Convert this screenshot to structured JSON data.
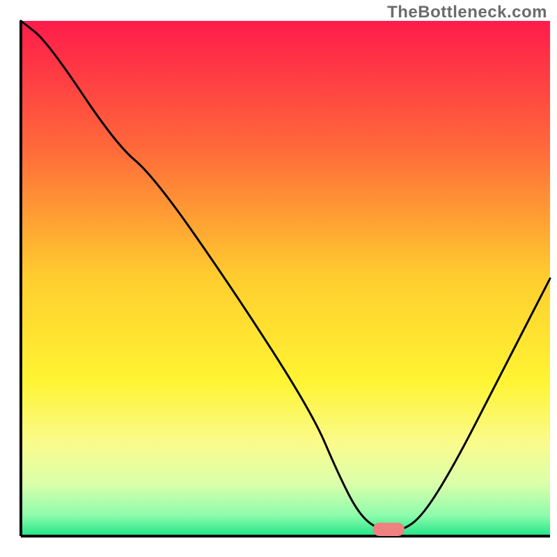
{
  "watermark": "TheBottleneck.com",
  "chart_data": {
    "type": "line",
    "title": "",
    "xlabel": "",
    "ylabel": "",
    "xlim": [
      0,
      100
    ],
    "ylim": [
      0,
      100
    ],
    "background": {
      "type": "vertical-gradient",
      "stops": [
        {
          "offset": 0.0,
          "color": "#ff1b4b"
        },
        {
          "offset": 0.25,
          "color": "#ff6a3a"
        },
        {
          "offset": 0.5,
          "color": "#ffce2e"
        },
        {
          "offset": 0.7,
          "color": "#fff433"
        },
        {
          "offset": 0.82,
          "color": "#fafb8c"
        },
        {
          "offset": 0.9,
          "color": "#d9ffab"
        },
        {
          "offset": 0.96,
          "color": "#8dfcac"
        },
        {
          "offset": 1.0,
          "color": "#1fe487"
        }
      ]
    },
    "axes": {
      "line_color": "#000000",
      "line_width": 4
    },
    "series": [
      {
        "name": "bottleneck-curve",
        "color": "#000000",
        "width": 3,
        "x": [
          0,
          5,
          18,
          25,
          40,
          55,
          60,
          64,
          68,
          72,
          76,
          82,
          90,
          98,
          100
        ],
        "y": [
          100,
          96,
          76,
          70,
          48,
          24,
          12,
          4,
          1,
          1,
          4,
          14,
          30,
          46,
          50
        ]
      }
    ],
    "marker": {
      "name": "optimal-marker",
      "shape": "rounded-pill",
      "x": 69.5,
      "y": 1.3,
      "width_x": 6,
      "height_y": 2.6,
      "color": "#ef8181"
    }
  }
}
